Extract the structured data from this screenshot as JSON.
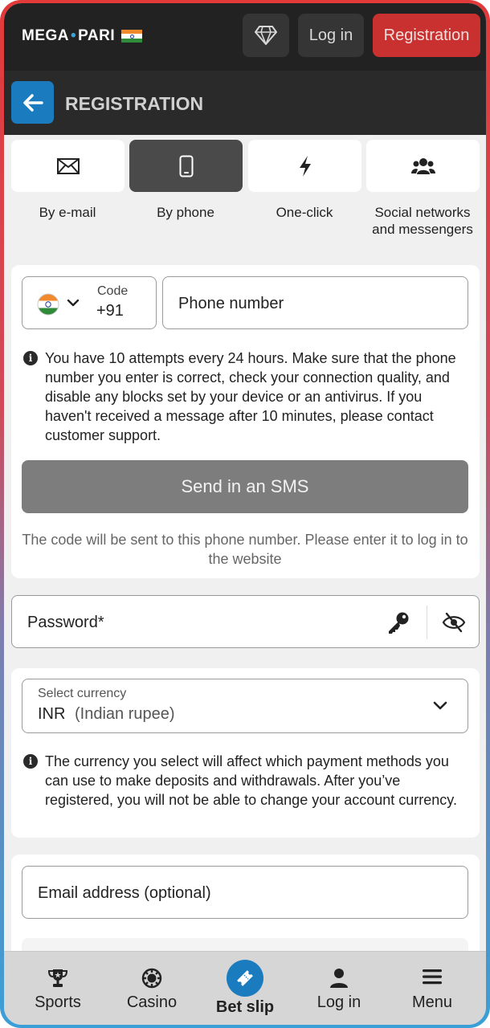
{
  "topbar": {
    "logo_left": "MEGA",
    "logo_right": "PARI",
    "login_label": "Log in",
    "registration_label": "Registration"
  },
  "header": {
    "title": "REGISTRATION"
  },
  "tabs": [
    {
      "label": "By e-mail",
      "icon": "envelope-icon"
    },
    {
      "label": "By phone",
      "icon": "smartphone-icon",
      "active": true
    },
    {
      "label": "One-click",
      "icon": "lightning-icon"
    },
    {
      "label": "Social networks and messengers",
      "icon": "users-icon"
    }
  ],
  "phone": {
    "code_label": "Code",
    "code_value": "+91",
    "phone_placeholder": "Phone number",
    "info": "You have 10 attempts every 24 hours. Make sure that the phone number you enter is correct, check your connection quality, and disable any blocks set by your device or an antivirus. If you haven't received a message after 10 minutes, please contact customer support.",
    "sms_button": "Send in an SMS",
    "sms_note": "The code will be sent to this phone number. Please enter it to log in to the website"
  },
  "password": {
    "placeholder": "Password*"
  },
  "currency": {
    "label": "Select currency",
    "code": "INR",
    "name": "(Indian rupee)",
    "info": "The currency you select will affect which payment methods you can use to make deposits and withdrawals. After you’ve registered, you will not be able to change your account currency."
  },
  "email": {
    "placeholder": "Email address (optional)"
  },
  "bottom_nav": [
    {
      "label": "Sports",
      "icon": "trophy-icon"
    },
    {
      "label": "Casino",
      "icon": "casino-chip-icon"
    },
    {
      "label": "Bet slip",
      "icon": "ticket-icon"
    },
    {
      "label": "Log in",
      "icon": "user-icon"
    },
    {
      "label": "Menu",
      "icon": "menu-icon"
    }
  ],
  "colors": {
    "accent_blue": "#1a7bbf",
    "registration_red": "#c8312f",
    "topbar_bg": "#222222"
  }
}
